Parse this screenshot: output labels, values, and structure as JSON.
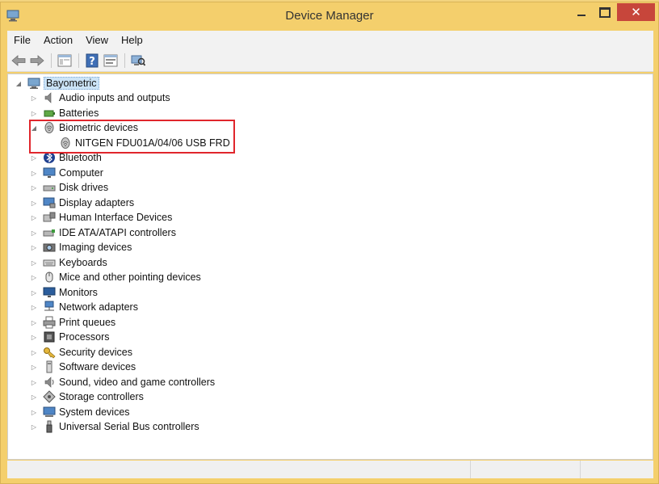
{
  "window": {
    "title": "Device Manager",
    "close_glyph": "✕"
  },
  "menu": [
    "File",
    "Action",
    "View",
    "Help"
  ],
  "toolbar": {
    "buttons": [
      "back-arrow-icon",
      "forward-arrow-icon",
      "show-hide-tree-icon",
      "help-icon",
      "properties-icon",
      "scan-hardware-icon"
    ]
  },
  "tree": {
    "root": {
      "label": "Bayometric",
      "icon": "computer-root-icon",
      "expanded": true
    },
    "categories": [
      {
        "label": "Audio inputs and outputs",
        "icon": "speaker-icon",
        "expanded": false
      },
      {
        "label": "Batteries",
        "icon": "battery-icon",
        "expanded": false
      },
      {
        "label": "Biometric devices",
        "icon": "fingerprint-icon",
        "expanded": true,
        "children": [
          {
            "label": "NITGEN FDU01A/04/06 USB FRD",
            "icon": "fingerprint-icon"
          }
        ]
      },
      {
        "label": "Bluetooth",
        "icon": "bluetooth-icon",
        "expanded": false
      },
      {
        "label": "Computer",
        "icon": "monitor-icon",
        "expanded": false
      },
      {
        "label": "Disk drives",
        "icon": "disk-drive-icon",
        "expanded": false
      },
      {
        "label": "Display adapters",
        "icon": "display-adapter-icon",
        "expanded": false
      },
      {
        "label": "Human Interface Devices",
        "icon": "hid-icon",
        "expanded": false
      },
      {
        "label": "IDE ATA/ATAPI controllers",
        "icon": "ide-controller-icon",
        "expanded": false
      },
      {
        "label": "Imaging devices",
        "icon": "camera-icon",
        "expanded": false
      },
      {
        "label": "Keyboards",
        "icon": "keyboard-icon",
        "expanded": false
      },
      {
        "label": "Mice and other pointing devices",
        "icon": "mouse-icon",
        "expanded": false
      },
      {
        "label": "Monitors",
        "icon": "monitor-icon",
        "expanded": false
      },
      {
        "label": "Network adapters",
        "icon": "network-icon",
        "expanded": false
      },
      {
        "label": "Print queues",
        "icon": "printer-icon",
        "expanded": false
      },
      {
        "label": "Processors",
        "icon": "processor-icon",
        "expanded": false
      },
      {
        "label": "Security devices",
        "icon": "key-icon",
        "expanded": false
      },
      {
        "label": "Software devices",
        "icon": "software-device-icon",
        "expanded": false
      },
      {
        "label": "Sound, video and game controllers",
        "icon": "speaker-icon",
        "expanded": false
      },
      {
        "label": "Storage controllers",
        "icon": "storage-icon",
        "expanded": false
      },
      {
        "label": "System devices",
        "icon": "system-icon",
        "expanded": false
      },
      {
        "label": "Universal Serial Bus controllers",
        "icon": "usb-icon",
        "expanded": false
      }
    ]
  },
  "colors": {
    "window_frame": "#f4cf6c",
    "close_button": "#c7463b",
    "highlight_box": "#e0262c",
    "selection": "#cce4f7"
  }
}
